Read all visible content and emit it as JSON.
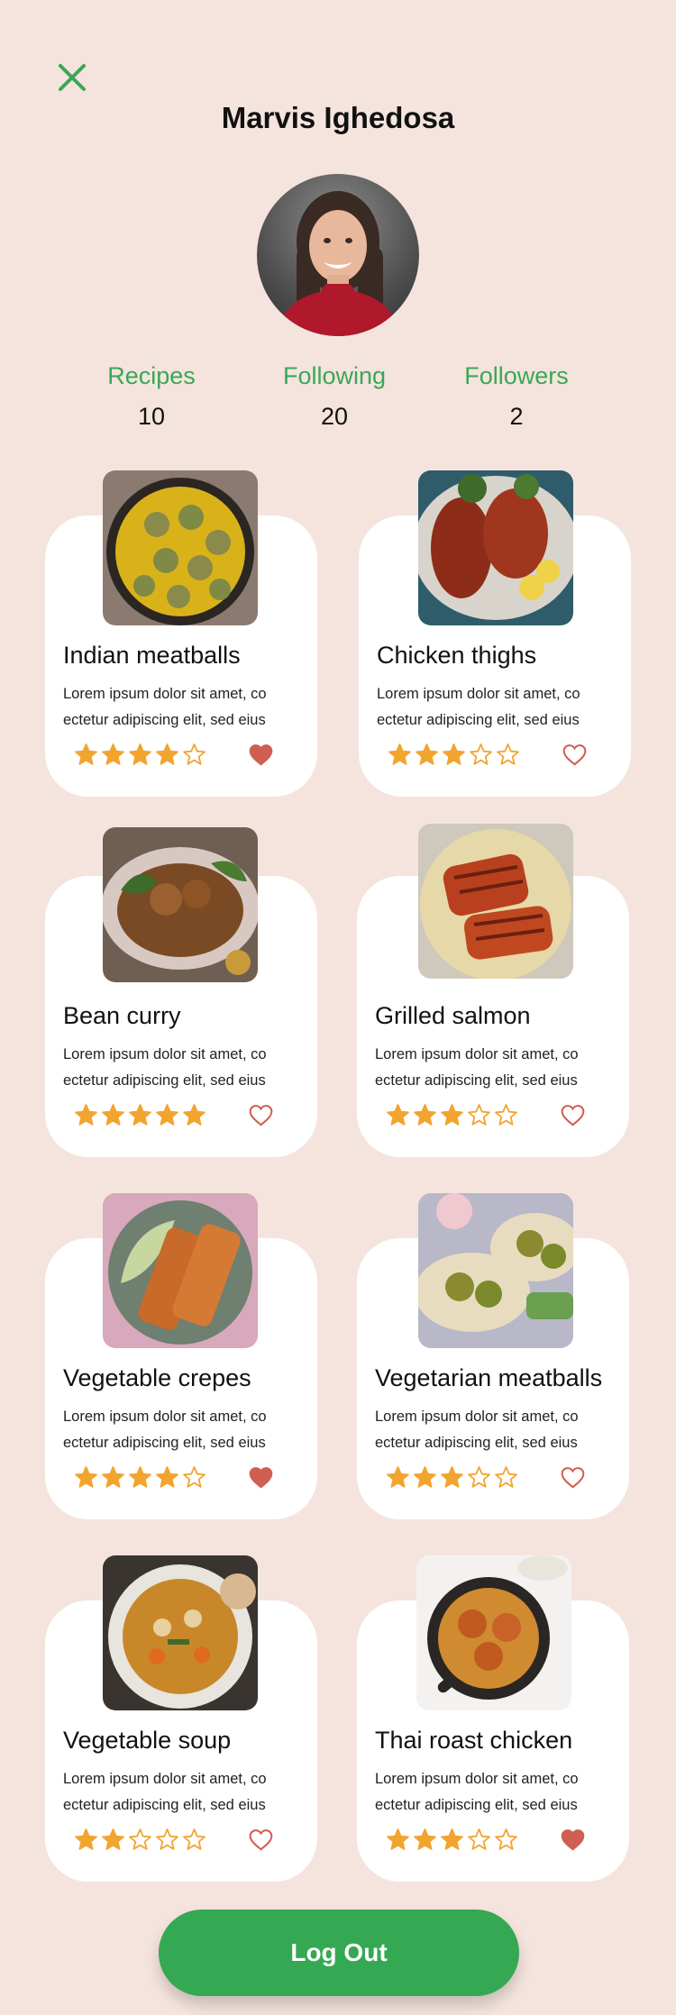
{
  "profile": {
    "name": "Marvis Ighedosa"
  },
  "stats": [
    {
      "label": "Recipes",
      "value": "10"
    },
    {
      "label": "Following",
      "value": "20"
    },
    {
      "label": "Followers",
      "value": "2"
    }
  ],
  "colors": {
    "background": "#f5e4de",
    "accent": "#3aa757",
    "button": "#34a853",
    "star": "#f2a42f",
    "heart": "#cf5f52"
  },
  "recipes": [
    {
      "title": "Indian meatballs",
      "description": "Lorem ipsum dolor sit amet, co ectetur adipiscing elit, sed eius",
      "rating": 4,
      "favorited": true,
      "image_icon": "meatballs-curry-image"
    },
    {
      "title": "Chicken thighs",
      "description": "Lorem ipsum dolor sit amet, co ectetur adipiscing elit, sed eius",
      "rating": 3,
      "favorited": false,
      "image_icon": "chicken-thighs-image"
    },
    {
      "title": "Bean curry",
      "description": "Lorem ipsum dolor sit amet, co ectetur adipiscing elit, sed eius",
      "rating": 5,
      "favorited": false,
      "image_icon": "bean-curry-image"
    },
    {
      "title": "Grilled salmon",
      "description": "Lorem ipsum dolor sit amet, co ectetur adipiscing elit, sed eius",
      "rating": 3,
      "favorited": false,
      "image_icon": "grilled-salmon-image"
    },
    {
      "title": "Vegetable crepes",
      "description": "Lorem ipsum dolor sit amet, co ectetur adipiscing elit, sed eius",
      "rating": 4,
      "favorited": true,
      "image_icon": "vegetable-crepes-image"
    },
    {
      "title": "Vegetarian meatballs",
      "description": "Lorem ipsum dolor sit amet, co ectetur adipiscing elit, sed eius",
      "rating": 3,
      "favorited": false,
      "image_icon": "vegetarian-meatballs-image"
    },
    {
      "title": "Vegetable soup",
      "description": "Lorem ipsum dolor sit amet, co ectetur adipiscing elit, sed eius",
      "rating": 2,
      "favorited": false,
      "image_icon": "vegetable-soup-image"
    },
    {
      "title": "Thai roast chicken",
      "description": "Lorem ipsum dolor sit amet, co ectetur adipiscing elit, sed eius",
      "rating": 3,
      "favorited": true,
      "image_icon": "thai-roast-chicken-image"
    }
  ],
  "actions": {
    "logout_label": "Log Out"
  }
}
